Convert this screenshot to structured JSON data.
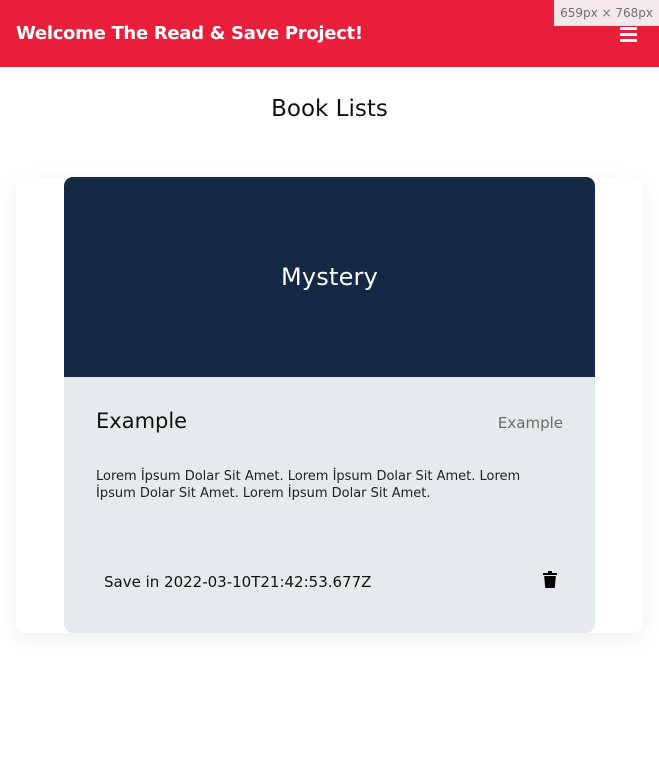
{
  "header": {
    "title": "Welcome The Read & Save Project!",
    "menu_icon": "hamburger-menu-icon",
    "accent_color": "#e91e3a"
  },
  "viewport_badge": "659px × 768px",
  "page": {
    "title": "Book Lists"
  },
  "books": [
    {
      "genre": "Mystery",
      "title": "Example",
      "author": "Example",
      "description": "Lorem İpsum Dolar Sit Amet. Lorem İpsum Dolar Sit Amet. Lorem İpsum Dolar Sit Amet. Lorem İpsum Dolar Sit Amet.",
      "saved_label": "Save in 2022-03-10T21:42:53.677Z",
      "delete_icon": "trash-icon",
      "cover_color": "#152944",
      "body_color": "#e5ebed"
    }
  ]
}
